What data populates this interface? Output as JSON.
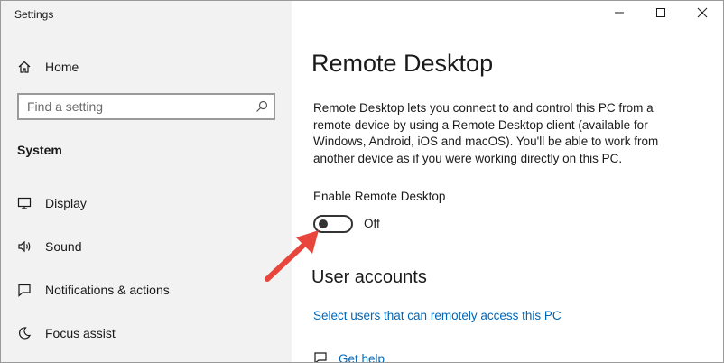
{
  "window": {
    "title": "Settings",
    "controls": {
      "minimize_icon": "minimize-icon",
      "maximize_icon": "maximize-icon",
      "close_icon": "close-icon"
    }
  },
  "sidebar": {
    "home": {
      "label": "Home",
      "icon": "home-icon"
    },
    "search": {
      "placeholder": "Find a setting",
      "value": "",
      "icon": "search-icon"
    },
    "section_title": "System",
    "items": [
      {
        "label": "Display",
        "icon": "display-icon"
      },
      {
        "label": "Sound",
        "icon": "sound-icon"
      },
      {
        "label": "Notifications & actions",
        "icon": "notifications-icon"
      },
      {
        "label": "Focus assist",
        "icon": "focus-assist-icon"
      }
    ]
  },
  "main": {
    "title": "Remote Desktop",
    "description": "Remote Desktop lets you connect to and control this PC from a remote device by using a Remote Desktop client (available for Windows, Android, iOS and macOS). You'll be able to work from another device as if you were working directly on this PC.",
    "toggle": {
      "label": "Enable Remote Desktop",
      "state_text": "Off",
      "on": false
    },
    "user_accounts": {
      "heading": "User accounts",
      "link": "Select users that can remotely access this PC"
    },
    "help": {
      "label": "Get help",
      "icon": "help-icon"
    }
  },
  "annotation": {
    "icon": "arrow-icon",
    "color": "#e8453c"
  },
  "colors": {
    "sidebar_bg": "#f2f2f2",
    "link": "#0067b8",
    "text": "#1a1a1a",
    "border": "#9a9a9a"
  }
}
